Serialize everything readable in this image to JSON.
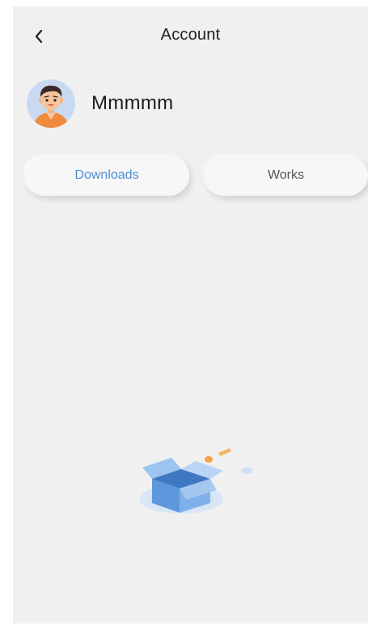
{
  "header": {
    "title": "Account"
  },
  "profile": {
    "username": "Mmmmm"
  },
  "tabs": [
    {
      "label": "Downloads",
      "active": true
    },
    {
      "label": "Works",
      "active": false
    }
  ],
  "icons": {
    "back": "back-chevron-icon",
    "avatar": "user-avatar-illustration",
    "empty_state": "open-box-illustration"
  },
  "colors": {
    "background": "#f0f0f1",
    "accent": "#4b8fd6",
    "text_primary": "#1f1f1f",
    "text_secondary": "#545454"
  }
}
